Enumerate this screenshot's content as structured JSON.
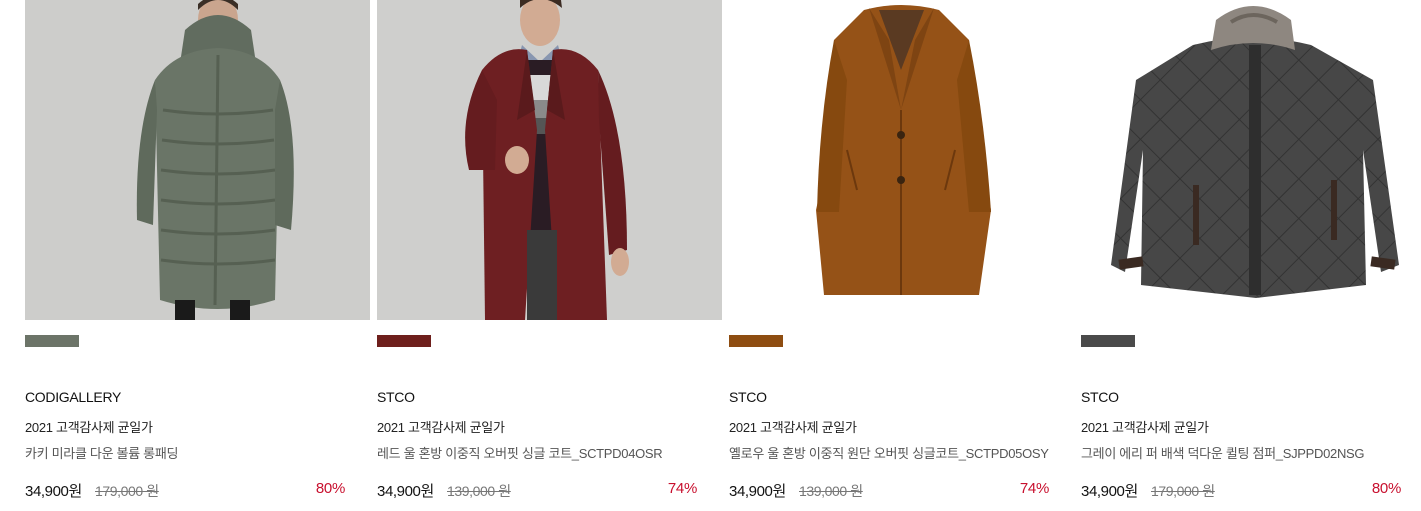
{
  "products": [
    {
      "brand": "CODIGALLERY",
      "promo": "2021 고객감사제 균일가",
      "name": "카키 미라클 다운 볼륨 롱패딩",
      "price": "34,900원",
      "original_price": "179,000 원",
      "discount": "80%",
      "color_swatch": "#6c7468",
      "image_background": "#cfcfcd"
    },
    {
      "brand": "STCO",
      "promo": "2021 고객감사제 균일가",
      "name": "레드 울 혼방 이중직 오버핏 싱글 코트_SCTPD04OSR",
      "price": "34,900원",
      "original_price": "139,000 원",
      "discount": "74%",
      "color_swatch": "#6e1f1c",
      "image_background": "#cfcfcd"
    },
    {
      "brand": "STCO",
      "promo": "2021 고객감사제 균일가",
      "name": "옐로우 울 혼방 이중직 원단 오버핏 싱글코트_SCTPD05OSY",
      "price": "34,900원",
      "original_price": "139,000 원",
      "discount": "74%",
      "color_swatch": "#8e4d11",
      "image_background": "#ffffff"
    },
    {
      "brand": "STCO",
      "promo": "2021 고객감사제 균일가",
      "name": "그레이 에리 퍼 배색 덕다운 퀼팅 점퍼_SJPPD02NSG",
      "price": "34,900원",
      "original_price": "179,000 원",
      "discount": "80%",
      "color_swatch": "#4a4a4a",
      "image_background": "#ffffff"
    }
  ]
}
